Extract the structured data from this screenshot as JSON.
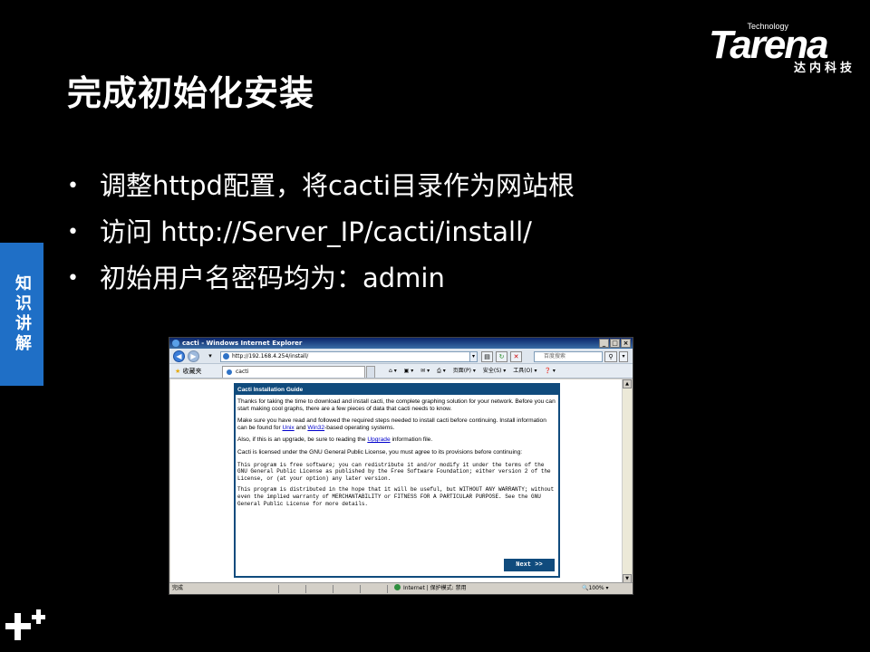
{
  "slide": {
    "title": "完成初始化安装",
    "bullets": [
      "调整httpd配置，将cacti目录作为网站根",
      "访问 http://Server_IP/cacti/install/",
      "初始用户名密码均为：admin"
    ],
    "side_tab": "知识讲解"
  },
  "logo": {
    "tech": "Technology",
    "word": "Tarena",
    "sub": "达内科技"
  },
  "browser": {
    "title": "cacti - Windows Internet Explorer",
    "address": "http://192.168.4.254/install/",
    "search_placeholder": "百度搜索",
    "favorites": "收藏夹",
    "tab": "cacti",
    "commands": [
      "页面(P) ▾",
      "安全(S) ▾",
      "工具(O) ▾",
      "❓ ▾"
    ],
    "status_left": "完成",
    "status_zone": "Internet | 保护模式: 禁用",
    "status_zoom": "🔍100% ▾"
  },
  "guide": {
    "heading": "Cacti Installation Guide",
    "p1": "Thanks for taking the time to download and install cacti, the complete graphing solution for your network. Before you can start making cool graphs, there are a few pieces of data that cacti needs to know.",
    "p2_before": "Make sure you have read and followed the required steps needed to install cacti before continuing. Install information can be found for ",
    "p2_link1": "Unix",
    "p2_mid": " and ",
    "p2_link2": "Win32",
    "p2_after": "-based operating systems.",
    "p3_before": "Also, if this is an upgrade, be sure to reading the ",
    "p3_link": "Upgrade",
    "p3_after": " information file.",
    "p4": "Cacti is licensed under the GNU General Public License, you must agree to its provisions before continuing:",
    "p5": "This program is free software; you can redistribute it and/or modify it under the terms of the GNU General Public License as published by the Free Software Foundation; either version 2 of the License, or (at your option) any later version.",
    "p6": "This program is distributed in the hope that it will be useful, but WITHOUT ANY WARRANTY; without even the implied warranty of MERCHANTABILITY or FITNESS FOR A PARTICULAR PURPOSE. See the GNU General Public License for more details.",
    "next": "Next >>"
  },
  "colors": {
    "slide_bg": "#000000",
    "side_tab": "#1f6fc6",
    "guide_header": "#104b7d"
  }
}
